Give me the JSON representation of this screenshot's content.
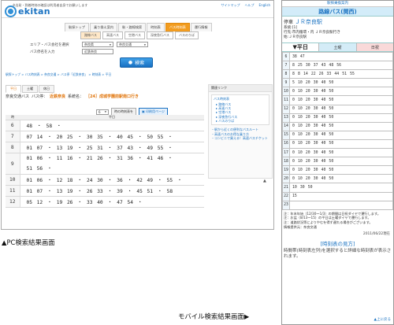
{
  "pc": {
    "top_note": "※出発・到着時刻の確認は利用者自身でお願いします",
    "logo_text": "ekitan",
    "top_links": [
      "サイトマップ",
      "ヘルプ",
      "English"
    ],
    "global_nav": [
      "駅探トップ",
      "乗り換え案内",
      "駅・路線検索",
      "時刻表",
      "バス時刻表",
      "運行情報"
    ],
    "global_nav_active": "バス時刻表",
    "sub_nav": [
      "路線バス",
      "高速バス",
      "空港バス",
      "深夜急行バス",
      "バスのりば"
    ],
    "form": {
      "area_label": "エリア・バス会社を選択",
      "area_value": "奈良県",
      "company_value": "奈良交通",
      "stop_label": "バス停名を入力",
      "stop_value": "近鉄奈良"
    },
    "search_button": "検索",
    "breadcrumb": "駅探トップ > バス時刻表 > 奈良交通 > バス停「近鉄奈良」 > 時刻表 > 平日",
    "tabs": [
      "平日",
      "土曜",
      "休日"
    ],
    "route_header": {
      "company": "奈良交通バス",
      "stop_label": "バス停：",
      "stop_name": "近鉄奈良",
      "system_label": "系統名：",
      "system_name": "［24］成城学園前駅南口行き"
    },
    "controls": {
      "select_value": "6",
      "button_label": "時の時刻表を",
      "print_label": "印刷用ページ"
    },
    "timetable_headers": {
      "hour": "時",
      "minutes": "平日"
    },
    "timetable": [
      {
        "hour": "6",
        "mins": "48 ・ 58 ・"
      },
      {
        "hour": "7",
        "mins": "07   14 ・ 20   25 ・ 30   35 ・ 40   45 ・ 50   55 ・"
      },
      {
        "hour": "8",
        "mins": "01   07 ・ 13   19 ・ 25   31 ・ 37   43 ・ 49   55 ・"
      },
      {
        "hour": "9",
        "mins": "01   06 ・ 11   16 ・ 21   26 ・ 31   36 ・ 41   46 ・",
        "mins2": "51   56 ・"
      },
      {
        "hour": "10",
        "mins": "01   06 ・ 12   18 ・ 24   30 ・ 36 ・ 42   49 ・ 55 ・"
      },
      {
        "hour": "11",
        "mins": "01   07 ・ 13   19 ・ 26   33 ・ 39 ・ 45   51 ・ 58"
      },
      {
        "hour": "12",
        "mins": "05   12 ・ 19   26 ・ 33   40 ・ 47   54 ・"
      }
    ],
    "side": {
      "title": "関連リンク",
      "box_title": "バス時刻表",
      "items": [
        "路線バス",
        "高速バス",
        "空港バス",
        "深夜急行バス",
        "バスのりば"
      ],
      "links": [
        "駅から近くの便利なバスルート",
        "高速バスのお得な乗り方",
        "コンビニで買える！高速バスチケット"
      ]
    },
    "caption": "▲PC検索結果画面"
  },
  "mobile": {
    "top": "駅探乗換案内",
    "banner": "路線バス(関西)",
    "stop_label": "停車",
    "stop_name": "ＪＲ奈良駅",
    "info": [
      "系統:[1]",
      "行先:市内循環・内 ＪＲ奈良駅行き",
      "始:ＪＲ奈良駅"
    ],
    "tabs": [
      "▼平日",
      "土曜",
      "日祝"
    ],
    "timetable": [
      {
        "hour": "6",
        "mins": "38  47"
      },
      {
        "hour": "7",
        "mins": "8  25  30  37  43  48  56"
      },
      {
        "hour": "8",
        "mins": "8  8  14  22  26  33  44  51  55"
      },
      {
        "hour": "9",
        "mins": "5  10  20  30  40  50"
      },
      {
        "hour": "10",
        "mins": "0  10  20  30  40  50"
      },
      {
        "hour": "11",
        "mins": "0  10  20  30  40  50"
      },
      {
        "hour": "12",
        "mins": "0  10  20  30  40  50"
      },
      {
        "hour": "13",
        "mins": "0  10  20  30  40  50"
      },
      {
        "hour": "14",
        "mins": "0  10  20  30  40  50"
      },
      {
        "hour": "15",
        "mins": "0  10  20  30  40  50"
      },
      {
        "hour": "16",
        "mins": "0  10  20  30  40  50"
      },
      {
        "hour": "17",
        "mins": "0  10  20  30  40  50"
      },
      {
        "hour": "18",
        "mins": "0  10  20  30  40  50"
      },
      {
        "hour": "19",
        "mins": "0  10  20  30  40  50"
      },
      {
        "hour": "20",
        "mins": "0  10  20  30  40  50"
      },
      {
        "hour": "21",
        "mins": "10  30  50"
      },
      {
        "hour": "22",
        "mins": "15"
      },
      {
        "hour": "23",
        "mins": ""
      }
    ],
    "notes": [
      "注：年末年始（12/30〜1/3）の期間は日祝ダイヤで運行します。",
      "注：お盆（8/13〜15）の平日は土曜ダイヤで運行します。",
      "注：道路状況等によりやむを得ず遅れる場合がございます。",
      "情報提供元：奈良交通"
    ],
    "date": "2011/06/22現在",
    "link": "[時刻表の見方]",
    "help": "時間帯(時刻表左列)を選択すると詳細な時刻表が表示されます。",
    "up": "▲上に戻る",
    "caption": "モバイル検索結果画面▶"
  }
}
